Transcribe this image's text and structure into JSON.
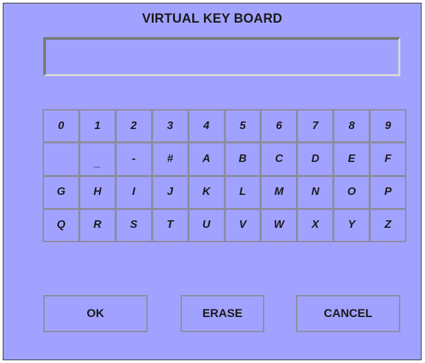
{
  "window": {
    "title": "VIRTUAL KEY BOARD"
  },
  "display": {
    "value": ""
  },
  "keyboard": {
    "rows": [
      [
        "0",
        "1",
        "2",
        "3",
        "4",
        "5",
        "6",
        "7",
        "8",
        "9"
      ],
      [
        "",
        "_",
        "-",
        "#",
        "A",
        "B",
        "C",
        "D",
        "E",
        "F"
      ],
      [
        "G",
        "H",
        "I",
        "J",
        "K",
        "L",
        "M",
        "N",
        "O",
        "P"
      ],
      [
        "Q",
        "R",
        "S",
        "T",
        "U",
        "V",
        "W",
        "X",
        "Y",
        "Z"
      ]
    ]
  },
  "buttons": {
    "ok_label": "OK",
    "erase_label": "ERASE",
    "cancel_label": "CANCEL"
  },
  "colors": {
    "background": "#a1a2ff",
    "key_border": "#8c8c9e"
  }
}
